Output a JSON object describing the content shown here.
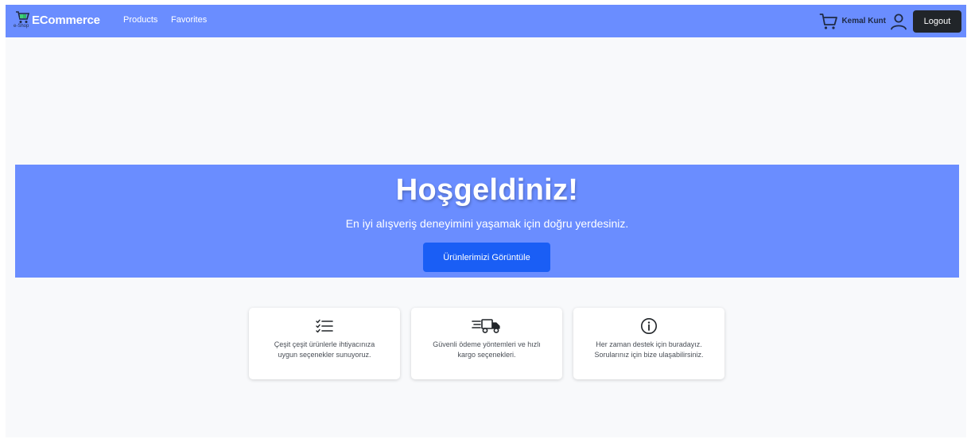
{
  "navbar": {
    "brand_name": "ECommerce",
    "brand_logo_sub": "e-Shop",
    "links": [
      "Products",
      "Favorites"
    ],
    "user_name": "Kemal Kunt",
    "logout_label": "Logout",
    "background_color": "#6a8dff"
  },
  "hero": {
    "title": "Hoşgeldiniz!",
    "subtitle": "En iyi alışveriş deneyimini yaşamak için doğru yerdesiniz.",
    "cta_label": "Ürünlerimizi Görüntüle",
    "cta_color": "#1a5ef5"
  },
  "features": [
    {
      "icon": "checklist-icon",
      "line1": "Çeşit çeşit ürünlerle ihtiyacınıza",
      "line2": "uygun seçenekler sunuyoruz."
    },
    {
      "icon": "fast-delivery-truck-icon",
      "line1": "Güvenli ödeme yöntemleri ve hızlı",
      "line2": "kargo seçenekleri."
    },
    {
      "icon": "info-circle-icon",
      "line1": "Her zaman destek için buradayız.",
      "line2": "Sorularınız için bize ulaşabilirsiniz."
    }
  ]
}
